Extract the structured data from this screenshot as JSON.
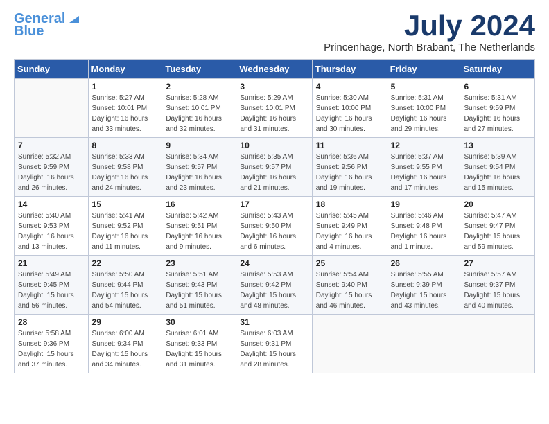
{
  "logo": {
    "line1": "General",
    "line2": "Blue"
  },
  "title": "July 2024",
  "subtitle": "Princenhage, North Brabant, The Netherlands",
  "header_days": [
    "Sunday",
    "Monday",
    "Tuesday",
    "Wednesday",
    "Thursday",
    "Friday",
    "Saturday"
  ],
  "weeks": [
    [
      {
        "day": "",
        "info": ""
      },
      {
        "day": "1",
        "info": "Sunrise: 5:27 AM\nSunset: 10:01 PM\nDaylight: 16 hours\nand 33 minutes."
      },
      {
        "day": "2",
        "info": "Sunrise: 5:28 AM\nSunset: 10:01 PM\nDaylight: 16 hours\nand 32 minutes."
      },
      {
        "day": "3",
        "info": "Sunrise: 5:29 AM\nSunset: 10:01 PM\nDaylight: 16 hours\nand 31 minutes."
      },
      {
        "day": "4",
        "info": "Sunrise: 5:30 AM\nSunset: 10:00 PM\nDaylight: 16 hours\nand 30 minutes."
      },
      {
        "day": "5",
        "info": "Sunrise: 5:31 AM\nSunset: 10:00 PM\nDaylight: 16 hours\nand 29 minutes."
      },
      {
        "day": "6",
        "info": "Sunrise: 5:31 AM\nSunset: 9:59 PM\nDaylight: 16 hours\nand 27 minutes."
      }
    ],
    [
      {
        "day": "7",
        "info": "Sunrise: 5:32 AM\nSunset: 9:59 PM\nDaylight: 16 hours\nand 26 minutes."
      },
      {
        "day": "8",
        "info": "Sunrise: 5:33 AM\nSunset: 9:58 PM\nDaylight: 16 hours\nand 24 minutes."
      },
      {
        "day": "9",
        "info": "Sunrise: 5:34 AM\nSunset: 9:57 PM\nDaylight: 16 hours\nand 23 minutes."
      },
      {
        "day": "10",
        "info": "Sunrise: 5:35 AM\nSunset: 9:57 PM\nDaylight: 16 hours\nand 21 minutes."
      },
      {
        "day": "11",
        "info": "Sunrise: 5:36 AM\nSunset: 9:56 PM\nDaylight: 16 hours\nand 19 minutes."
      },
      {
        "day": "12",
        "info": "Sunrise: 5:37 AM\nSunset: 9:55 PM\nDaylight: 16 hours\nand 17 minutes."
      },
      {
        "day": "13",
        "info": "Sunrise: 5:39 AM\nSunset: 9:54 PM\nDaylight: 16 hours\nand 15 minutes."
      }
    ],
    [
      {
        "day": "14",
        "info": "Sunrise: 5:40 AM\nSunset: 9:53 PM\nDaylight: 16 hours\nand 13 minutes."
      },
      {
        "day": "15",
        "info": "Sunrise: 5:41 AM\nSunset: 9:52 PM\nDaylight: 16 hours\nand 11 minutes."
      },
      {
        "day": "16",
        "info": "Sunrise: 5:42 AM\nSunset: 9:51 PM\nDaylight: 16 hours\nand 9 minutes."
      },
      {
        "day": "17",
        "info": "Sunrise: 5:43 AM\nSunset: 9:50 PM\nDaylight: 16 hours\nand 6 minutes."
      },
      {
        "day": "18",
        "info": "Sunrise: 5:45 AM\nSunset: 9:49 PM\nDaylight: 16 hours\nand 4 minutes."
      },
      {
        "day": "19",
        "info": "Sunrise: 5:46 AM\nSunset: 9:48 PM\nDaylight: 16 hours\nand 1 minute."
      },
      {
        "day": "20",
        "info": "Sunrise: 5:47 AM\nSunset: 9:47 PM\nDaylight: 15 hours\nand 59 minutes."
      }
    ],
    [
      {
        "day": "21",
        "info": "Sunrise: 5:49 AM\nSunset: 9:45 PM\nDaylight: 15 hours\nand 56 minutes."
      },
      {
        "day": "22",
        "info": "Sunrise: 5:50 AM\nSunset: 9:44 PM\nDaylight: 15 hours\nand 54 minutes."
      },
      {
        "day": "23",
        "info": "Sunrise: 5:51 AM\nSunset: 9:43 PM\nDaylight: 15 hours\nand 51 minutes."
      },
      {
        "day": "24",
        "info": "Sunrise: 5:53 AM\nSunset: 9:42 PM\nDaylight: 15 hours\nand 48 minutes."
      },
      {
        "day": "25",
        "info": "Sunrise: 5:54 AM\nSunset: 9:40 PM\nDaylight: 15 hours\nand 46 minutes."
      },
      {
        "day": "26",
        "info": "Sunrise: 5:55 AM\nSunset: 9:39 PM\nDaylight: 15 hours\nand 43 minutes."
      },
      {
        "day": "27",
        "info": "Sunrise: 5:57 AM\nSunset: 9:37 PM\nDaylight: 15 hours\nand 40 minutes."
      }
    ],
    [
      {
        "day": "28",
        "info": "Sunrise: 5:58 AM\nSunset: 9:36 PM\nDaylight: 15 hours\nand 37 minutes."
      },
      {
        "day": "29",
        "info": "Sunrise: 6:00 AM\nSunset: 9:34 PM\nDaylight: 15 hours\nand 34 minutes."
      },
      {
        "day": "30",
        "info": "Sunrise: 6:01 AM\nSunset: 9:33 PM\nDaylight: 15 hours\nand 31 minutes."
      },
      {
        "day": "31",
        "info": "Sunrise: 6:03 AM\nSunset: 9:31 PM\nDaylight: 15 hours\nand 28 minutes."
      },
      {
        "day": "",
        "info": ""
      },
      {
        "day": "",
        "info": ""
      },
      {
        "day": "",
        "info": ""
      }
    ]
  ]
}
